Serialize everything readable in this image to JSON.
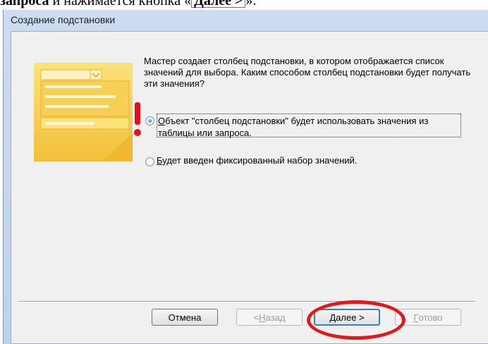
{
  "doc_snippet": {
    "prefix": "запроса",
    "middle": " и нажимается кнопка «",
    "boxed": "Далее >",
    "suffix": "»."
  },
  "window": {
    "title": "Создание подстановки"
  },
  "description": "Мастер создает столбец подстановки, в котором отображается список значений для выбора.  Каким способом столбец подстановки будет получать эти значения?",
  "options": [
    {
      "label_first": "О",
      "label_rest": "бъект \"столбец подстановки\" будет использовать значения из таблицы или запроса.",
      "selected": true
    },
    {
      "label_first": "Б",
      "label_rest": "удет введен фиксированный набор значений.",
      "selected": false
    }
  ],
  "buttons": {
    "cancel": "Отмена",
    "back_prefix": "< ",
    "back_key": "Н",
    "back_rest": "азад",
    "next_key": "Д",
    "next_rest": "алее >",
    "finish_key": "Г",
    "finish_rest": "отово"
  },
  "colors": {
    "accent_yellow": "#f5c542",
    "highlight_red": "#e01a1a",
    "title_bar": "#c5d7ee"
  },
  "icons": {
    "wizard_art": "lookup-list-illustration",
    "exclaim": "exclamation-mark"
  }
}
